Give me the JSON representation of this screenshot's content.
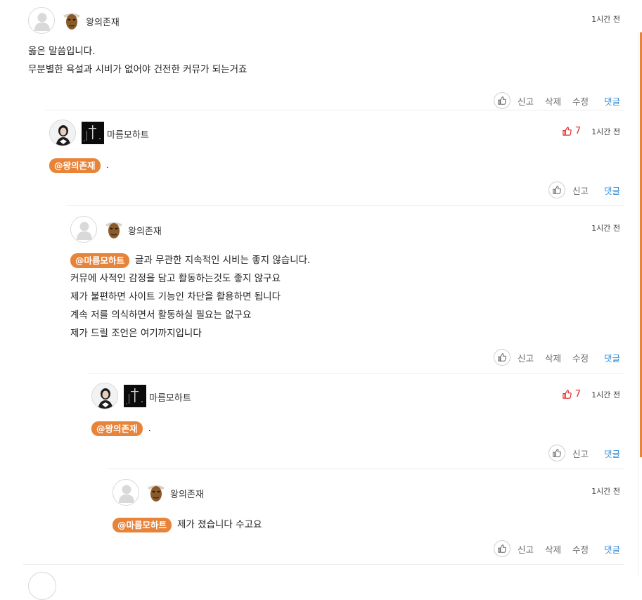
{
  "colors": {
    "accent": "#e8833a",
    "reply_link": "#3a8fd8",
    "like_count": "#e02424"
  },
  "icons": {
    "default_avatar": "person-silhouette-icon",
    "like": "thumbs-up-icon",
    "liked": "thumbs-up-filled-icon"
  },
  "comments": [
    {
      "author": "왕의존재",
      "time": "1시간 전",
      "avatar": "default",
      "badge": "mask",
      "mention": "",
      "lines": [
        "옳은 말씀입니다.",
        "무분별한 욕설과 시비가 없어야 건전한 커뮤가 되는거죠"
      ],
      "likes": "",
      "actions": {
        "report": "신고",
        "delete": "삭제",
        "edit": "수정",
        "reply": "댓글"
      }
    },
    {
      "author": "마름모하트",
      "time": "1시간 전",
      "avatar": "photo",
      "badge": "dark",
      "mention": "@왕의존재",
      "lines": [
        "."
      ],
      "likes": "7",
      "actions": {
        "report": "신고",
        "reply": "댓글"
      }
    },
    {
      "author": "왕의존재",
      "time": "1시간 전",
      "avatar": "default",
      "badge": "mask",
      "mention": "@마름모하트",
      "lines": [
        "글과 무관한 지속적인 시비는 좋지 않습니다.",
        "커뮤에 사적인 감정을 담고 활동하는것도 좋지 않구요",
        "제가 불편하면 사이트 기능인 차단을 활용하면 됩니다",
        "계속 저를 의식하면서 활동하실 필요는 없구요",
        "제가 드릴 조언은 여기까지입니다"
      ],
      "likes": "",
      "actions": {
        "report": "신고",
        "delete": "삭제",
        "edit": "수정",
        "reply": "댓글"
      }
    },
    {
      "author": "마름모하트",
      "time": "1시간 전",
      "avatar": "photo",
      "badge": "dark",
      "mention": "@왕의존재",
      "lines": [
        "."
      ],
      "likes": "7",
      "actions": {
        "report": "신고",
        "reply": "댓글"
      }
    },
    {
      "author": "왕의존재",
      "time": "1시간 전",
      "avatar": "default",
      "badge": "mask",
      "mention": "@마름모하트",
      "lines": [
        "제가 졌습니다 수고요"
      ],
      "likes": "",
      "actions": {
        "report": "신고",
        "delete": "삭제",
        "edit": "수정",
        "reply": "댓글"
      }
    }
  ]
}
